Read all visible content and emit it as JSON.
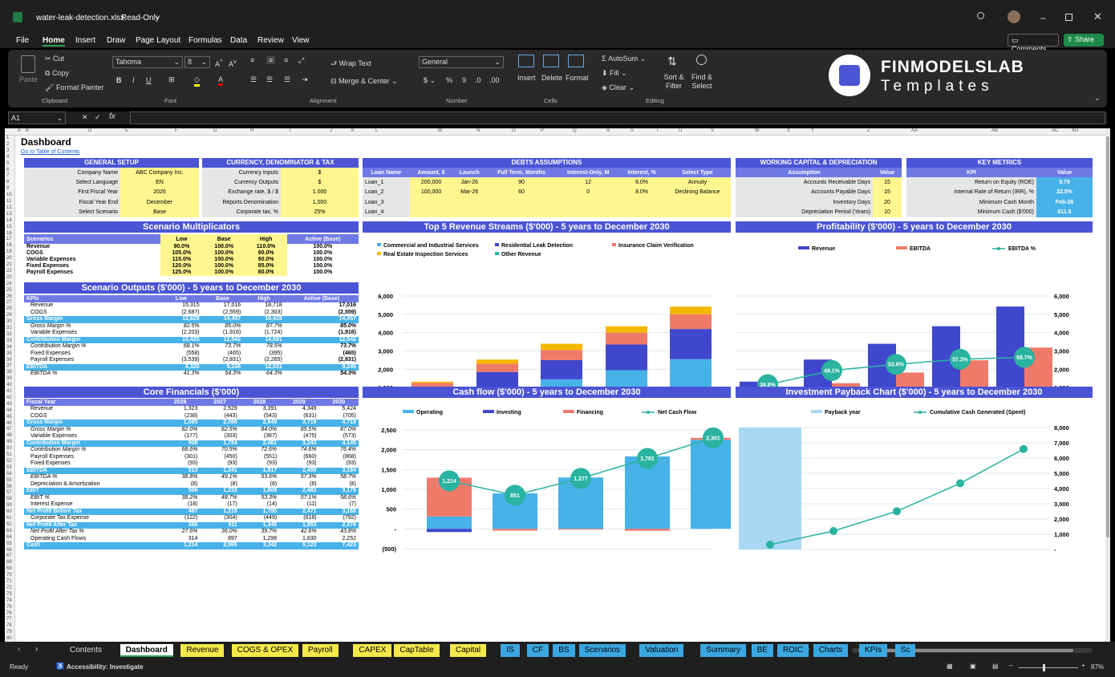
{
  "app": {
    "filename": "water-leak-detection.xlsx",
    "mode": "Read-Only",
    "comments_label": "Comments",
    "share_label": "Share"
  },
  "menu": [
    "File",
    "Home",
    "Insert",
    "Draw",
    "Page Layout",
    "Formulas",
    "Data",
    "Review",
    "View"
  ],
  "ribbon": {
    "paste": "Paste",
    "cut": "Cut",
    "copy": "Copy",
    "format_painter": "Format Painter",
    "clipboard": "Clipboard",
    "font_name": "Tahoma",
    "font_size": "8",
    "font_group": "Font",
    "wrap_text": "Wrap Text",
    "merge_center": "Merge & Center",
    "alignment": "Alignment",
    "number_format": "General",
    "number_group": "Number",
    "insert": "Insert",
    "delete": "Delete",
    "format": "Format",
    "cells": "Cells",
    "autosum": "AutoSum",
    "fill": "Fill",
    "clear": "Clear",
    "sort_filter": "Sort & Filter",
    "find_select": "Find & Select",
    "editing": "Editing",
    "logo_main": "FINMODELSLAB",
    "logo_sub": "Templates"
  },
  "formula_bar": {
    "cell_ref": "A1",
    "fx": "fx"
  },
  "col_headers": [
    "A",
    "B",
    "D",
    "E",
    "F",
    "G",
    "H",
    "I",
    "J",
    "K",
    "L",
    "M",
    "N",
    "O",
    "P",
    "Q",
    "R",
    "S",
    "T",
    "U",
    "V",
    "W",
    "X",
    "Y",
    "Z",
    "AA",
    "AB",
    "AC",
    "AD"
  ],
  "sheet": {
    "title": "Dashboard",
    "toc_link": "Go to Table of Contents"
  },
  "general_setup": {
    "title": "GENERAL SETUP",
    "rows": [
      [
        "Company Name",
        "ABC Company Inc."
      ],
      [
        "Select Language",
        "EN"
      ],
      [
        "First Fiscal Year",
        "2026"
      ],
      [
        "Fiscal Year End",
        "December"
      ],
      [
        "Select Scenario",
        "Base"
      ]
    ]
  },
  "currency": {
    "title": "CURRENCY, DENOMINATOR & TAX",
    "rows": [
      [
        "Currency Inputs",
        "$"
      ],
      [
        "Currency Outputs",
        "$"
      ],
      [
        "Exchange rate, $ / $",
        "1.000"
      ],
      [
        "Reports Denomination",
        "1,000"
      ],
      [
        "Corporate tax, %",
        "25%"
      ]
    ]
  },
  "debts": {
    "title": "DEBTS ASSUMPTIONS",
    "headers": [
      "Loan Name",
      "Amount, $",
      "Launch",
      "Full Term, Months",
      "Interest-Only, M",
      "Interest, %",
      "Select Type"
    ],
    "rows": [
      [
        "Loan_1",
        "200,000",
        "Jan-26",
        "90",
        "12",
        "6.0%",
        "Annuity"
      ],
      [
        "Loan_2",
        "100,000",
        "Mar-26",
        "60",
        "0",
        "8.0%",
        "Declining Balance"
      ],
      [
        "Loan_3",
        "",
        "",
        "",
        "",
        "",
        ""
      ],
      [
        "Loan_4",
        "",
        "",
        "",
        "",
        "",
        ""
      ]
    ]
  },
  "wc": {
    "title": "WORKING CAPITAL & DEPRECIATION",
    "headers": [
      "Assumption",
      "Value"
    ],
    "rows": [
      [
        "Accounts Receivable Days",
        "15"
      ],
      [
        "Accounts Payable Days",
        "15"
      ],
      [
        "Inventory Days",
        "20"
      ],
      [
        "Depreciation Period (Years)",
        "10"
      ]
    ]
  },
  "key_metrics": {
    "title": "KEY METRICS",
    "headers": [
      "KPI",
      "Value"
    ],
    "rows": [
      [
        "Return on Equity (ROE)",
        "9.79"
      ],
      [
        "Internal Rate of Return (IRR), %",
        "22.5%"
      ],
      [
        "Minimum Cash Month",
        "Feb-26"
      ],
      [
        "Minimum Cash ($'000)",
        "811.5"
      ]
    ]
  },
  "multipliers": {
    "title": "Scenario Multiplicators",
    "headers": [
      "Scenarios",
      "Low",
      "Base",
      "High",
      "Active (Base)"
    ],
    "rows": [
      [
        "Revenue",
        "90.0%",
        "100.0%",
        "110.0%",
        "100.0%"
      ],
      [
        "COGS",
        "105.0%",
        "100.0%",
        "90.0%",
        "100.0%"
      ],
      [
        "Variable Expenses",
        "115.0%",
        "100.0%",
        "90.0%",
        "100.0%"
      ],
      [
        "Fixed Expenses",
        "120.0%",
        "100.0%",
        "85.0%",
        "100.0%"
      ],
      [
        "Payroll Expenses",
        "125.0%",
        "100.0%",
        "80.0%",
        "100.0%"
      ]
    ]
  },
  "scenario_outputs": {
    "title": "Scenario Outputs ($'000) - 5 years to December 2030",
    "headers": [
      "KPIs",
      "Low",
      "Base",
      "High",
      "Active (Base)"
    ],
    "rows": [
      [
        "Revenue",
        "15,315",
        "17,016",
        "18,718",
        "17,016"
      ],
      [
        "COGS",
        "(2,687)",
        "(2,559)",
        "(2,303)",
        "(2,559)"
      ],
      [
        "Gross Margin",
        "12,628",
        "14,457",
        "16,415",
        "14,457"
      ],
      [
        "Gross Margin %",
        "82.5%",
        "85.0%",
        "87.7%",
        "85.0%"
      ],
      [
        "Variable Expenses",
        "(2,203)",
        "(1,916)",
        "(1,724)",
        "(1,916)"
      ],
      [
        "Contribution Margin",
        "10,425",
        "12,542",
        "14,691",
        "12,542"
      ],
      [
        "Contribution Margin %",
        "68.1%",
        "73.7%",
        "78.5%",
        "73.7%"
      ],
      [
        "Fixed Expenses",
        "(558)",
        "(465)",
        "(395)",
        "(465)"
      ],
      [
        "Payroll Expenses",
        "(3,539)",
        "(2,831)",
        "(2,265)",
        "(2,831)"
      ],
      [
        "EBITDA",
        "6,328",
        "9,246",
        "12,031",
        "9,246"
      ],
      [
        "EBITDA %",
        "41.3%",
        "54.3%",
        "64.3%",
        "54.3%"
      ]
    ]
  },
  "core_fin": {
    "title": "Core Financials ($'000)",
    "headers": [
      "Fiscal Year",
      "2026",
      "2027",
      "2028",
      "2029",
      "2030"
    ],
    "rows": [
      [
        "Revenue",
        "1,323",
        "2,529",
        "3,391",
        "4,349",
        "5,424"
      ],
      [
        "COGS",
        "(238)",
        "(443)",
        "(543)",
        "(631)",
        "(705)"
      ],
      [
        "Gross Margin",
        "1,085",
        "2,086",
        "2,849",
        "3,719",
        "4,719"
      ],
      [
        "Gross Margin %",
        "82.0%",
        "82.5%",
        "84.0%",
        "85.5%",
        "87.0%"
      ],
      [
        "Variable Expenses",
        "(177)",
        "(303)",
        "(387)",
        "(475)",
        "(573)"
      ],
      [
        "Contribution Margin",
        "908",
        "1,784",
        "2,461",
        "3,243",
        "4,145"
      ],
      [
        "Contribution Margin %",
        "68.6%",
        "70.5%",
        "72.6%",
        "74.6%",
        "76.4%"
      ],
      [
        "Payroll Expenses",
        "(301)",
        "(450)",
        "(551)",
        "(660)",
        "(868)"
      ],
      [
        "Fixed Expenses",
        "(93)",
        "(93)",
        "(93)",
        "(93)",
        "(93)"
      ],
      [
        "EBITDA",
        "513",
        "1,241",
        "1,817",
        "2,490",
        "3,184"
      ],
      [
        "EBITDA %",
        "38.8%",
        "49.1%",
        "53.6%",
        "57.3%",
        "58.7%"
      ],
      [
        "Depreciation & Amortization",
        "(8)",
        "(8)",
        "(8)",
        "(8)",
        "(8)"
      ],
      [
        "EBIT",
        "506",
        "1,233",
        "1,809",
        "2,482",
        "3,176"
      ],
      [
        "EBIT %",
        "38.2%",
        "48.7%",
        "53.3%",
        "57.1%",
        "58.6%"
      ],
      [
        "Interest Expense",
        "(18)",
        "(17)",
        "(14)",
        "(11)",
        "(7)"
      ],
      [
        "Net Profit Before Tax",
        "487",
        "1,215",
        "1,795",
        "2,471",
        "3,168"
      ],
      [
        "Corporate Tax Expense",
        "(122)",
        "(304)",
        "(449)",
        "(618)",
        "(792)"
      ],
      [
        "Net Profit After Tax",
        "366",
        "911",
        "1,346",
        "1,853",
        "2,376"
      ],
      [
        "Net Profit After Tax %",
        "27.6%",
        "36.0%",
        "39.7%",
        "42.6%",
        "43.8%"
      ],
      [
        "Operating Cash Flows",
        "314",
        "897",
        "1,298",
        "1,830",
        "2,252"
      ],
      [
        "Cash",
        "1,214",
        "2,065",
        "3,342",
        "5,123",
        "7,423"
      ]
    ]
  },
  "chart_data": [
    {
      "type": "bar",
      "title": "Top 5 Revenue Streams ($'000) - 5 years to December 2030",
      "categories": [
        "2026",
        "2027",
        "2028",
        "2029",
        "2030"
      ],
      "ylim": [
        0,
        6000
      ],
      "yticks": [
        "-",
        "1,000",
        "2,000",
        "3,000",
        "4,000",
        "5,000",
        "6,000"
      ],
      "stacked": true,
      "series": [
        {
          "name": "Commercial and Industrial Services",
          "color": "#47b2e8",
          "values": [
            550,
            1050,
            1450,
            1950,
            2550
          ]
        },
        {
          "name": "Residential Leak Detection",
          "color": "#3f48cc",
          "values": [
            450,
            800,
            1050,
            1400,
            1650
          ]
        },
        {
          "name": "Insurance Claim Verification",
          "color": "#f07a6a",
          "values": [
            250,
            450,
            550,
            650,
            800
          ]
        },
        {
          "name": "Real Estate Inspection Services",
          "color": "#f5b800",
          "values": [
            70,
            230,
            340,
            350,
            420
          ]
        },
        {
          "name": "Other Revenue",
          "color": "#2ab3a0",
          "values": [
            0,
            0,
            0,
            0,
            0
          ]
        }
      ]
    },
    {
      "type": "bar",
      "title": "Profitability ($'000) - 5 years to December 2030",
      "categories": [
        "2026",
        "2027",
        "2028",
        "2029",
        "2030"
      ],
      "ylim": [
        0,
        6000
      ],
      "yticks": [
        "-",
        "1,000",
        "2,000",
        "3,000",
        "4,000",
        "5,000",
        "6,000"
      ],
      "series": [
        {
          "name": "Revenue",
          "color": "#3f48cc",
          "values": [
            1323,
            2529,
            3391,
            4349,
            5424
          ]
        },
        {
          "name": "EBITDA",
          "color": "#f07a6a",
          "values": [
            513,
            1241,
            1817,
            2490,
            3184
          ]
        },
        {
          "name": "EBITDA %",
          "color": "#2ab3a0",
          "values": [
            38.8,
            49.1,
            53.6,
            57.3,
            58.7
          ],
          "labels": [
            "38.8%",
            "49.1%",
            "53.6%",
            "57.3%",
            "58.7%"
          ]
        }
      ]
    },
    {
      "type": "bar",
      "title": "Cash flow ($'000) - 5 years to December 2030",
      "categories": [
        "2026",
        "2027",
        "2028",
        "2029",
        "2030"
      ],
      "ylim": [
        -500,
        2500
      ],
      "yticks": [
        "(500)",
        "-",
        "500",
        "1,000",
        "1,500",
        "2,000",
        "2,500"
      ],
      "series": [
        {
          "name": "Operating",
          "color": "#47b2e8",
          "values": [
            314,
            897,
            1298,
            1830,
            2252
          ]
        },
        {
          "name": "Investing",
          "color": "#3f48cc",
          "values": [
            -80,
            0,
            0,
            0,
            0
          ]
        },
        {
          "name": "Financing",
          "color": "#f07a6a",
          "values": [
            980,
            -46,
            -21,
            -49,
            48
          ]
        },
        {
          "name": "Net Cash Flow",
          "color": "#2ab3a0",
          "values": [
            1214,
            851,
            1277,
            1781,
            2301
          ],
          "labels": [
            "1,214",
            "851",
            "1,277",
            "1,781",
            "2,301"
          ]
        }
      ]
    },
    {
      "type": "line",
      "title": "Investment Payback Chart ($'000) - 5 years to December 2030",
      "categories": [
        "2026",
        "2027",
        "2028",
        "2029",
        "2030"
      ],
      "ylim": [
        0,
        8000
      ],
      "yticks": [
        "-",
        "1,000",
        "2,000",
        "3,000",
        "4,000",
        "5,000",
        "6,000",
        "7,000",
        "8,000"
      ],
      "series": [
        {
          "name": "Payback year",
          "color": "#a9d8f2",
          "values": [
            1,
            0,
            0,
            0,
            0
          ]
        },
        {
          "name": "Cumulative Cash Generated (Spent)",
          "color": "#2ab3a0",
          "values": [
            314,
            1211,
            2509,
            4339,
            6591
          ]
        }
      ]
    }
  ],
  "tabs": [
    {
      "label": "Contents",
      "style": "plain"
    },
    {
      "label": "Dashboard",
      "style": "active"
    },
    {
      "label": "Revenue",
      "style": "yellow"
    },
    {
      "label": "COGS & OPEX",
      "style": "yellow"
    },
    {
      "label": "Payroll",
      "style": "yellow"
    },
    {
      "label": "CAPEX",
      "style": "yellow"
    },
    {
      "label": "CapTable",
      "style": "yellow"
    },
    {
      "label": "Capital",
      "style": "yellow"
    },
    {
      "label": "IS",
      "style": "blue"
    },
    {
      "label": "CF",
      "style": "blue"
    },
    {
      "label": "BS",
      "style": "blue"
    },
    {
      "label": "Scenarios",
      "style": "blue"
    },
    {
      "label": "Valuation",
      "style": "blue"
    },
    {
      "label": "Summary",
      "style": "blue"
    },
    {
      "label": "BE",
      "style": "blue"
    },
    {
      "label": "ROIC",
      "style": "blue"
    },
    {
      "label": "Charts",
      "style": "blue"
    },
    {
      "label": "KPIs",
      "style": "blue"
    },
    {
      "label": "Sc",
      "style": "blue"
    }
  ],
  "status": {
    "ready": "Ready",
    "accessibility": "Accessibility: Investigate",
    "zoom": "87%"
  }
}
